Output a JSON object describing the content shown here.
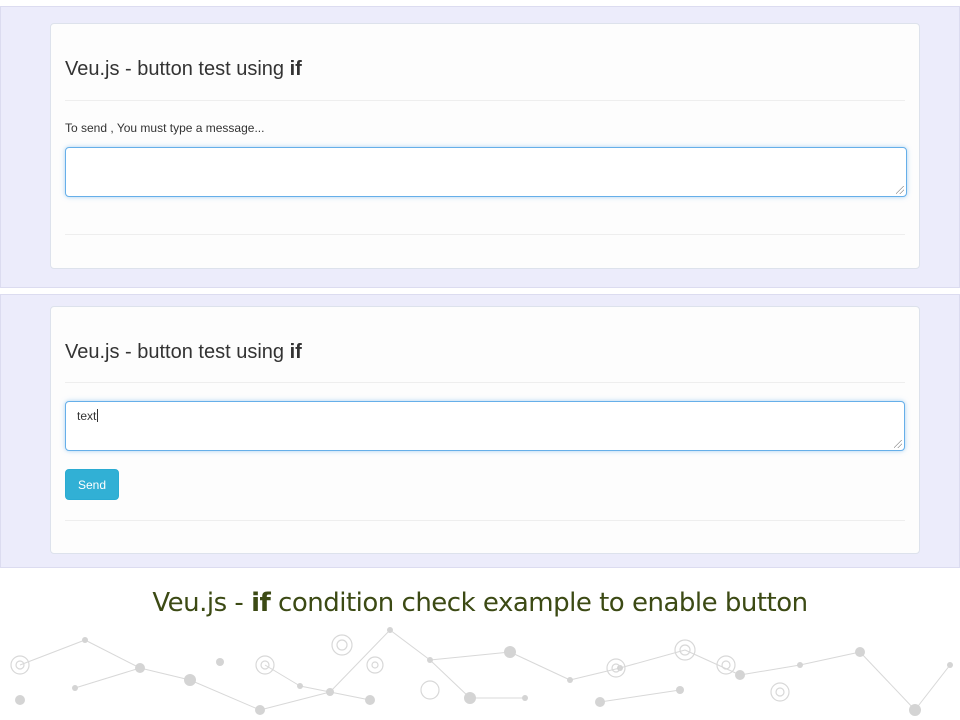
{
  "shots": [
    {
      "title_prefix": "Veu.js - button test using ",
      "title_keyword": "if",
      "hint": "To send , You must type a message...",
      "message_value": ""
    },
    {
      "title_prefix": "Veu.js - button test using ",
      "title_keyword": "if",
      "message_value": "text",
      "send_label": "Send"
    }
  ],
  "caption": {
    "prefix": "Veu.js - ",
    "keyword": "if",
    "suffix": " condition check example to enable button"
  },
  "colors": {
    "panel_bg": "#ececfb",
    "focus_border": "#66afe9",
    "send_button": "#31b0d5",
    "caption_text": "#3c4a14"
  }
}
